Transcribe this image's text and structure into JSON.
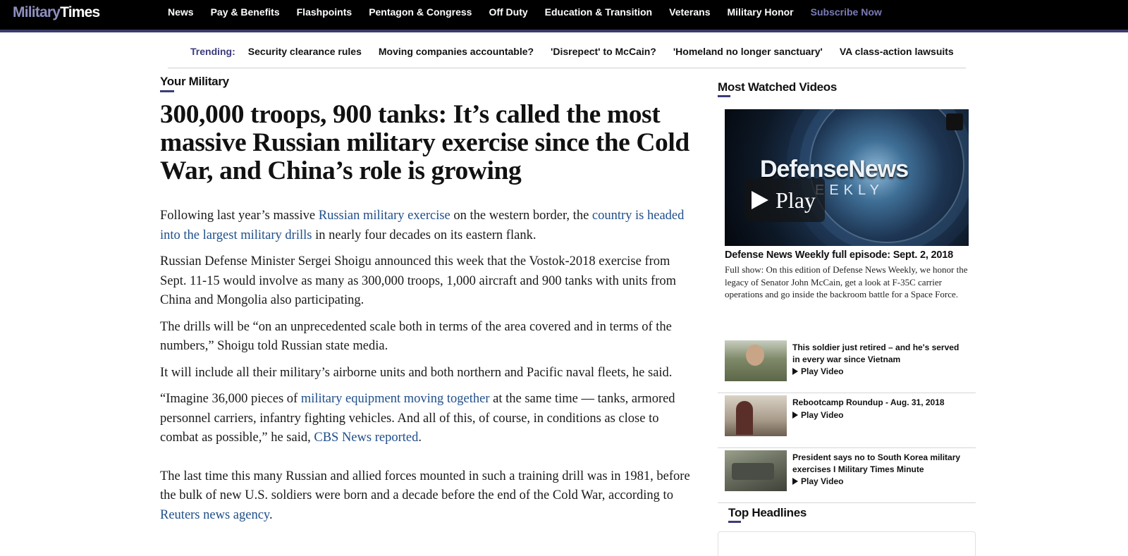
{
  "brand": {
    "part1": "Military",
    "part2": "Times"
  },
  "nav": {
    "items": [
      "News",
      "Pay & Benefits",
      "Flashpoints",
      "Pentagon & Congress",
      "Off Duty",
      "Education & Transition",
      "Veterans",
      "Military Honor"
    ],
    "subscribe": "Subscribe Now"
  },
  "trending": {
    "label": "Trending:",
    "items": [
      "Security clearance rules",
      "Moving companies accountable?",
      "'Disrepect' to McCain?",
      "'Homeland no longer sanctuary'",
      "VA class-action lawsuits"
    ]
  },
  "article": {
    "section": "Your Military",
    "headline": "300,000 troops, 900 tanks: It’s called the most massive Russian military exercise since the Cold War, and China’s role is growing",
    "p1": {
      "t1": "Following last year’s massive ",
      "link1": "Russian military exercise",
      "t2": " on the western border, the ",
      "link2": "country is headed into the largest military drills",
      "t3": " in nearly four decades on its eastern flank."
    },
    "p2": "Russian Defense Minister Sergei Shoigu announced this week that the Vostok-2018 exercise from Sept. 11-15 would involve as many as 300,000 troops, 1,000 aircraft and 900 tanks with units from China and Mongolia also participating.",
    "p3": "The drills will be “on an unprecedented scale both in terms of the area covered and in terms of the numbers,” Shoigu told Russian state media.",
    "p4": "It will include all their military’s airborne units and both northern and Pacific naval fleets, he said.",
    "p5": {
      "t1": "“Imagine 36,000 pieces of ",
      "link1": "military equipment moving together",
      "t2": " at the same time — tanks, armored personnel carriers, infantry fighting vehicles. And all of this, of course, in conditions as close to combat as possible,” he said, ",
      "link2": "CBS News reported",
      "t3": "."
    },
    "p6": {
      "t1": "The last time this many Russian and allied forces mounted in such a training drill was in 1981, before the bulk of new U.S. soldiers were born and a decade before the end of the Cold War, according to ",
      "link1": "Reuters news agency",
      "t2": "."
    }
  },
  "sidebar": {
    "videos_title": "Most Watched Videos",
    "player": {
      "brand": "DefenseNews",
      "sub": "EEKLY",
      "play_label": "Play"
    },
    "featured": {
      "title": "Defense News Weekly full episode: Sept. 2, 2018",
      "description": "Full show: On this edition of Defense News Weekly, we honor the legacy of Senator John McCain, get a look at F-35C carrier operations and go inside the backroom battle for a Space Force."
    },
    "videos": [
      {
        "title": "This soldier just retired – and he's served in every war since Vietnam",
        "play": "Play Video"
      },
      {
        "title": "Rebootcamp Roundup - Aug. 31, 2018",
        "play": "Play Video"
      },
      {
        "title": "President says no to South Korea military exercises I Military Times Minute",
        "play": "Play Video"
      }
    ],
    "headlines_title": "Top Headlines"
  }
}
